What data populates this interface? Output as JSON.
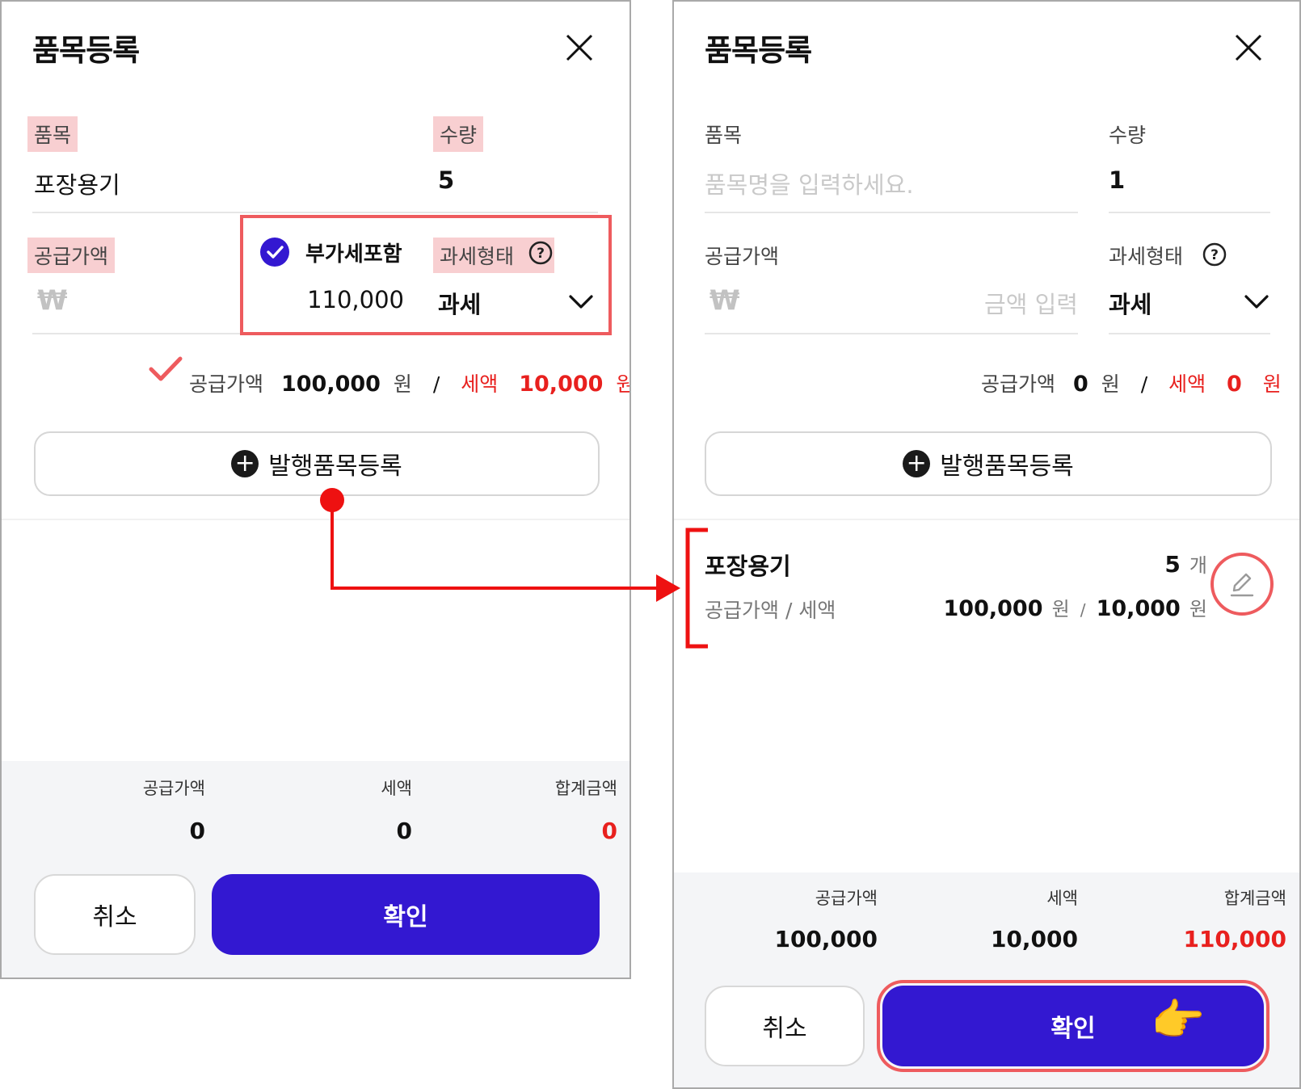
{
  "left": {
    "title": "품목등록",
    "item_label": "품목",
    "item_value": "포장용기",
    "qty_label": "수량",
    "qty_value": "5",
    "supply_label": "공급가액",
    "won_symbol": "₩",
    "vat_include_label": "부가세포함",
    "vat_include_checked": true,
    "amount_value": "110,000",
    "tax_type_label": "과세형태",
    "tax_type_value": "과세",
    "calc": {
      "supply_label": "공급가액",
      "supply_value": "100,000",
      "supply_unit": "원",
      "separator": "/",
      "tax_label": "세액",
      "tax_value": "10,000",
      "tax_unit": "원"
    },
    "add_button": "발행품목등록",
    "footer": {
      "supply_label": "공급가액",
      "supply_value": "0",
      "tax_label": "세액",
      "tax_value": "0",
      "total_label": "합계금액",
      "total_value": "0"
    },
    "cancel": "취소",
    "confirm": "확인"
  },
  "right": {
    "title": "품목등록",
    "item_label": "품목",
    "item_placeholder": "품목명을 입력하세요.",
    "qty_label": "수량",
    "qty_value": "1",
    "supply_label": "공급가액",
    "won_symbol": "₩",
    "amount_placeholder": "금액 입력",
    "tax_type_label": "과세형태",
    "tax_type_value": "과세",
    "calc": {
      "supply_label": "공급가액",
      "supply_value": "0",
      "supply_unit": "원",
      "separator": "/",
      "tax_label": "세액",
      "tax_value": "0",
      "tax_unit": "원"
    },
    "add_button": "발행품목등록",
    "registered_item": {
      "name": "포장용기",
      "qty": "5",
      "qty_unit": "개",
      "sub_label": "공급가액 / 세액",
      "supply_value": "100,000",
      "supply_unit": "원",
      "separator": "/",
      "tax_value": "10,000",
      "tax_unit": "원"
    },
    "footer": {
      "supply_label": "공급가액",
      "supply_value": "100,000",
      "tax_label": "세액",
      "tax_value": "10,000",
      "total_label": "합계금액",
      "total_value": "110,000"
    },
    "cancel": "취소",
    "confirm": "확인"
  },
  "colors": {
    "primary": "#3318d1",
    "accent_red": "#e8201e",
    "highlight": "#f8cfd1",
    "annotation": "#ee5b5e"
  }
}
